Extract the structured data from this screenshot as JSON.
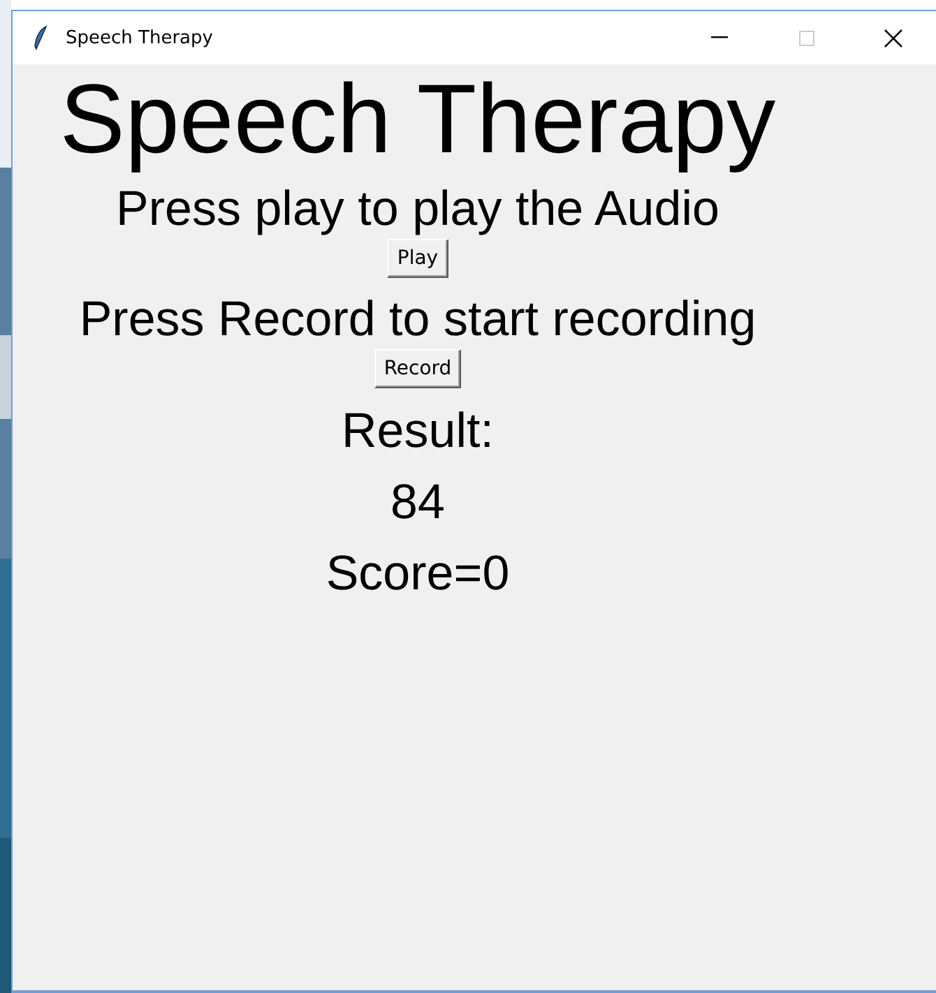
{
  "window": {
    "title": "Speech Therapy"
  },
  "content": [
    {
      "kind": "heading",
      "text": "Speech Therapy"
    },
    {
      "kind": "prompt",
      "text": "Press play to play the Audio"
    },
    {
      "kind": "button",
      "text": "Play"
    },
    {
      "kind": "prompt",
      "text": "Press Record to start recording"
    },
    {
      "kind": "button",
      "text": "Record"
    },
    {
      "kind": "result",
      "text": "Result:"
    },
    {
      "kind": "result",
      "text": "84"
    },
    {
      "kind": "result",
      "text": "Score=0"
    }
  ]
}
